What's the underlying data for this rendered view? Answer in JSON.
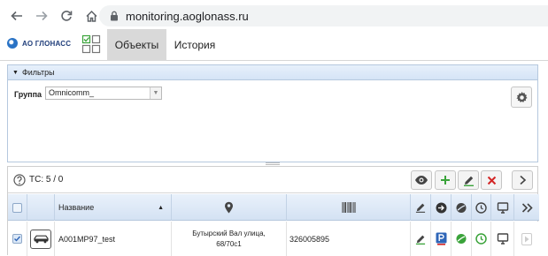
{
  "browser": {
    "url": "monitoring.aoglonass.ru",
    "icons": [
      "back-arrow-icon",
      "forward-arrow-icon",
      "reload-icon",
      "home-icon",
      "lock-icon"
    ]
  },
  "app": {
    "logo_text": "АО ГЛОНАСС",
    "tabs": [
      {
        "label": "Объекты",
        "active": true
      },
      {
        "label": "История",
        "active": false
      }
    ]
  },
  "filters": {
    "title": "Фильтры",
    "group_label": "Группа",
    "group_value": "Omnicomm_"
  },
  "objects": {
    "count_label": "ТС: 5 / 0",
    "columns": {
      "name": "Название"
    },
    "rows": [
      {
        "name": "A001MP97_test",
        "address": "Бутырский Вал улица,",
        "address_line2": "68/70с1",
        "id": "326005895",
        "checked": true
      }
    ]
  },
  "colors": {
    "accent_green": "#3aa33a",
    "delete_red": "#d32626",
    "parking_blue": "#2f66b8",
    "header_blue": "#d5e4f6"
  }
}
